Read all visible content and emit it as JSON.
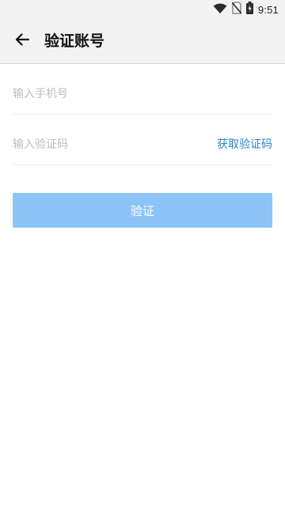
{
  "status_bar": {
    "time": "9:51",
    "icons": [
      "wifi-icon",
      "no-sim-icon",
      "battery-charging-icon"
    ]
  },
  "header": {
    "title": "验证账号",
    "back_icon": "back-arrow-icon"
  },
  "form": {
    "phone_placeholder": "输入手机号",
    "code_placeholder": "输入验证码",
    "get_code_label": "获取验证码",
    "verify_label": "验证"
  },
  "colors": {
    "accent": "#2a86c3",
    "button_disabled": "#8cc4f7",
    "divider": "#eeeeee"
  }
}
